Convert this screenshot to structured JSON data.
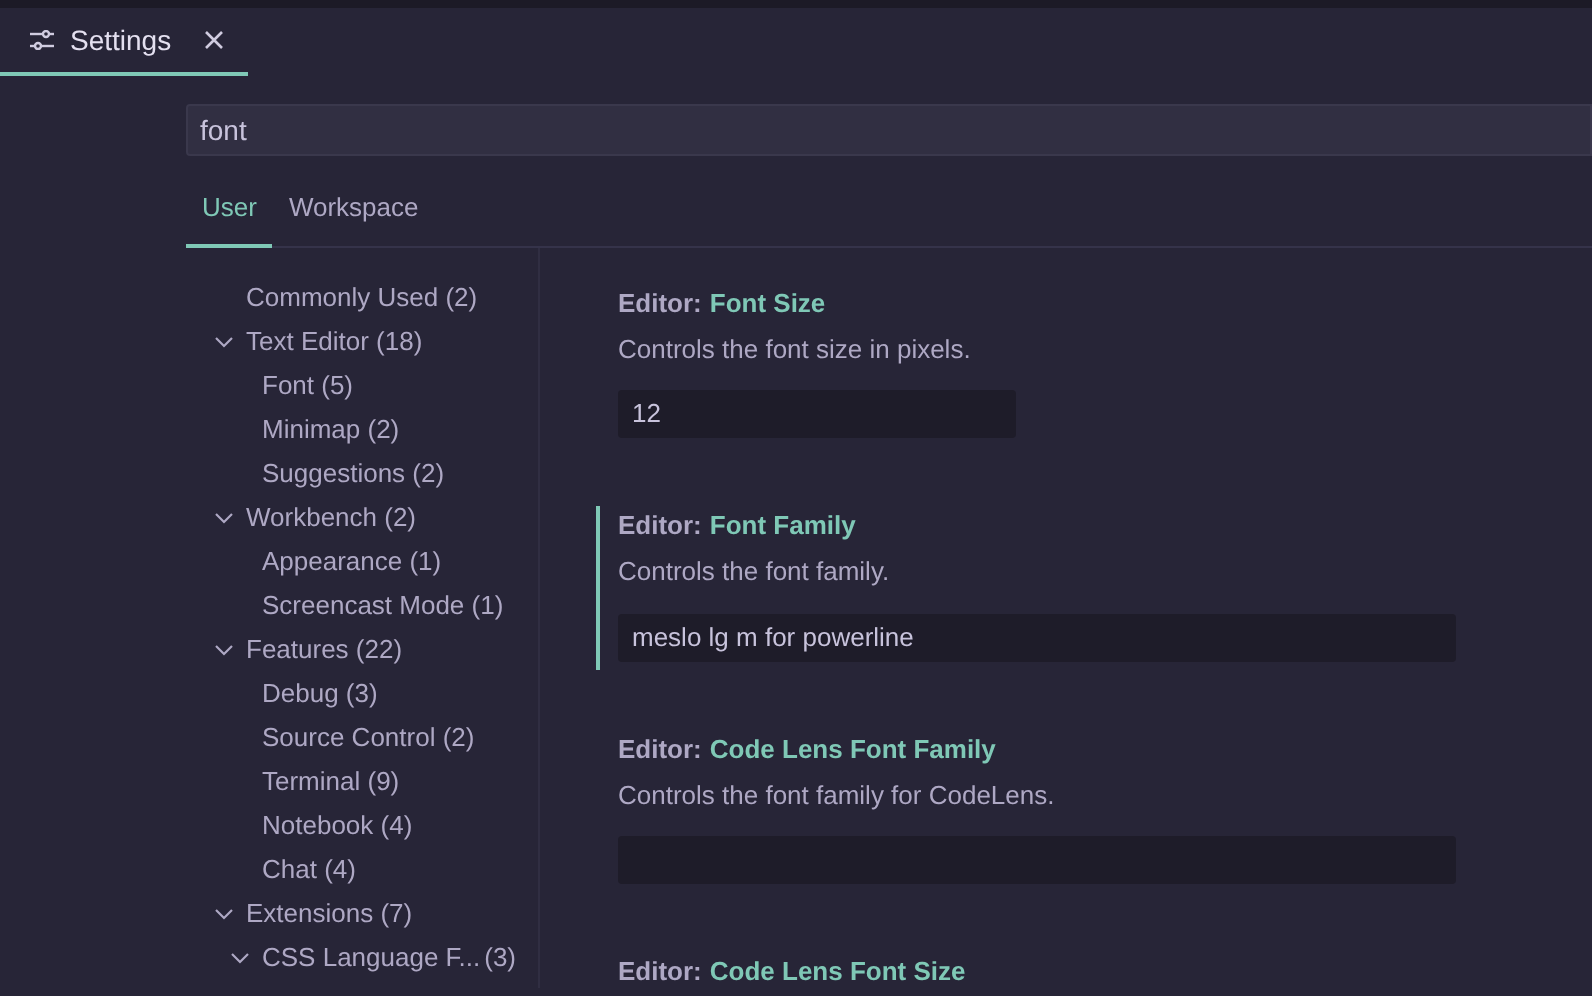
{
  "editor_tab": {
    "title": "Settings",
    "selected": true
  },
  "search": {
    "value": "font"
  },
  "scope_tabs": [
    {
      "label": "User",
      "selected": true
    },
    {
      "label": "Workspace",
      "selected": false
    }
  ],
  "toc": [
    {
      "label": "Commonly Used (2)"
    },
    {
      "label": "Text Editor (18)",
      "expanded": true,
      "children": [
        {
          "label": "Font (5)"
        },
        {
          "label": "Minimap (2)"
        },
        {
          "label": "Suggestions (2)"
        }
      ]
    },
    {
      "label": "Workbench (2)",
      "expanded": true,
      "children": [
        {
          "label": "Appearance (1)"
        },
        {
          "label": "Screencast Mode (1)"
        }
      ]
    },
    {
      "label": "Features (22)",
      "expanded": true,
      "children": [
        {
          "label": "Debug (3)"
        },
        {
          "label": "Source Control (2)"
        },
        {
          "label": "Terminal (9)"
        },
        {
          "label": "Notebook (4)"
        },
        {
          "label": "Chat (4)"
        }
      ]
    },
    {
      "label": "Extensions (7)",
      "expanded": true,
      "children": [
        {
          "label": "CSS Language F...",
          "count": "(3)",
          "expanded": true
        }
      ]
    }
  ],
  "settings": [
    {
      "category": "Editor:",
      "name": "Font Size",
      "description": "Controls the font size in pixels.",
      "value": "12",
      "kind": "short_field",
      "modified": false
    },
    {
      "category": "Editor:",
      "name": "Font Family",
      "description": "Controls the font family.",
      "value": "meslo lg m for powerline",
      "kind": "long_field",
      "modified": true
    },
    {
      "category": "Editor:",
      "name": "Code Lens Font Family",
      "description": "Controls the font family for CodeLens.",
      "kind": "long_field",
      "modified": false
    },
    {
      "category": "Editor:",
      "name": "Code Lens Font Size"
    }
  ]
}
